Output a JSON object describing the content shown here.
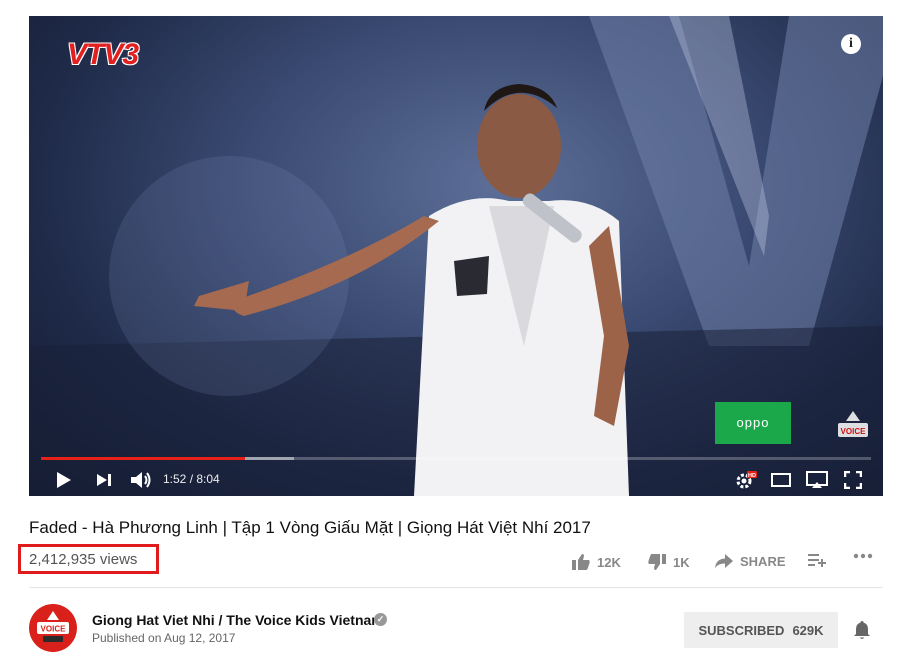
{
  "video": {
    "channel_logo_text": "VTV3",
    "sponsor_text": "oppo",
    "progress_fraction": 0.246,
    "buffered_fraction": 0.305,
    "time_display": "1:52 / 8:04"
  },
  "title": "Faded - Hà Phương Linh | Tập 1 Vòng Giấu Mặt | Giọng Hát Việt Nhí 2017",
  "views": "2,412,935 views",
  "actions": {
    "like_count": "12K",
    "dislike_count": "1K",
    "share_label": "SHARE"
  },
  "channel": {
    "name": "Giong Hat Viet Nhi / The Voice Kids Vietnam",
    "published": "Published on Aug 12, 2017",
    "avatar_text": "VOICE KIDS"
  },
  "subscribe": {
    "label": "SUBSCRIBED",
    "count": "629K"
  },
  "colors": {
    "progress": "#e62117",
    "highlight_box": "#e01b1b",
    "sponsor_green": "#1ba84a",
    "avatar_red": "#d9201a"
  }
}
